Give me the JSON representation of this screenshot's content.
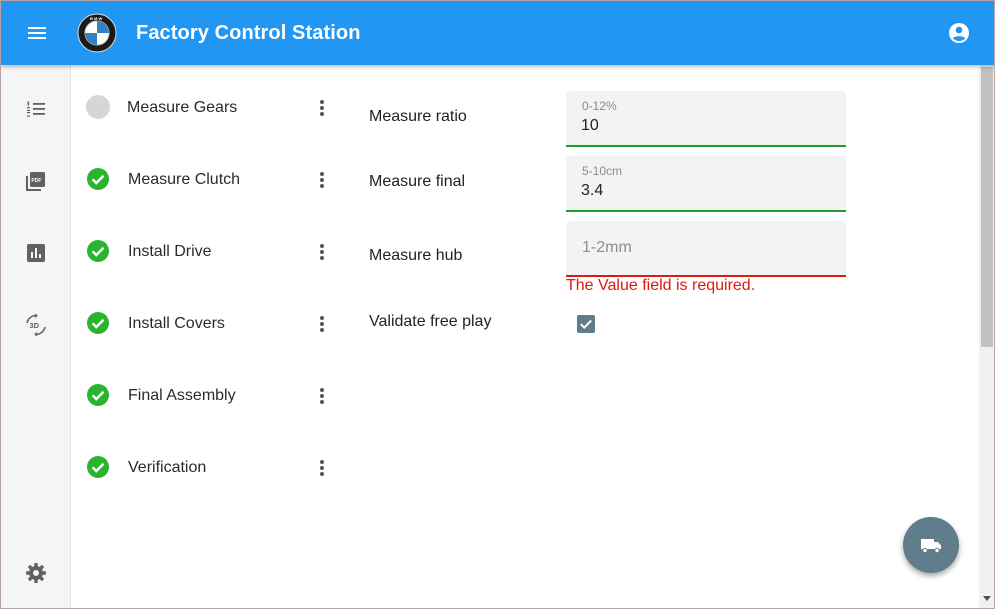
{
  "app": {
    "title": "Factory Control Station",
    "brand_color": "#2196f3"
  },
  "header": {
    "menu_icon": "menu-icon",
    "logo": "bmw-logo",
    "account_icon": "account-circle-icon"
  },
  "rail": {
    "items": [
      {
        "icon": "format-list-numbered-icon"
      },
      {
        "icon": "pdf-icon"
      },
      {
        "icon": "bar-chart-icon"
      },
      {
        "icon": "3d-rotation-icon"
      }
    ],
    "bottom_icon": "settings-icon"
  },
  "steps": [
    {
      "label": "Measure Gears",
      "status": "pending"
    },
    {
      "label": "Measure Clutch",
      "status": "done"
    },
    {
      "label": "Install Drive",
      "status": "done"
    },
    {
      "label": "Install Covers",
      "status": "done"
    },
    {
      "label": "Final Assembly",
      "status": "done"
    },
    {
      "label": "Verification",
      "status": "done"
    }
  ],
  "form": {
    "measure_ratio": {
      "label": "Measure ratio",
      "hint": "0-12%",
      "value": "10"
    },
    "measure_final": {
      "label": "Measure final",
      "hint": "5-10cm",
      "value": "3.4"
    },
    "measure_hub": {
      "label": "Measure hub",
      "placeholder": "1-2mm",
      "value": "",
      "error": "The Value field is required."
    },
    "validate_free_play": {
      "label": "Validate free play",
      "checked": true
    }
  },
  "fab": {
    "icon": "truck-icon"
  },
  "colors": {
    "success": "#1e9c2d",
    "error": "#e0190e",
    "fab": "#607d8b"
  }
}
